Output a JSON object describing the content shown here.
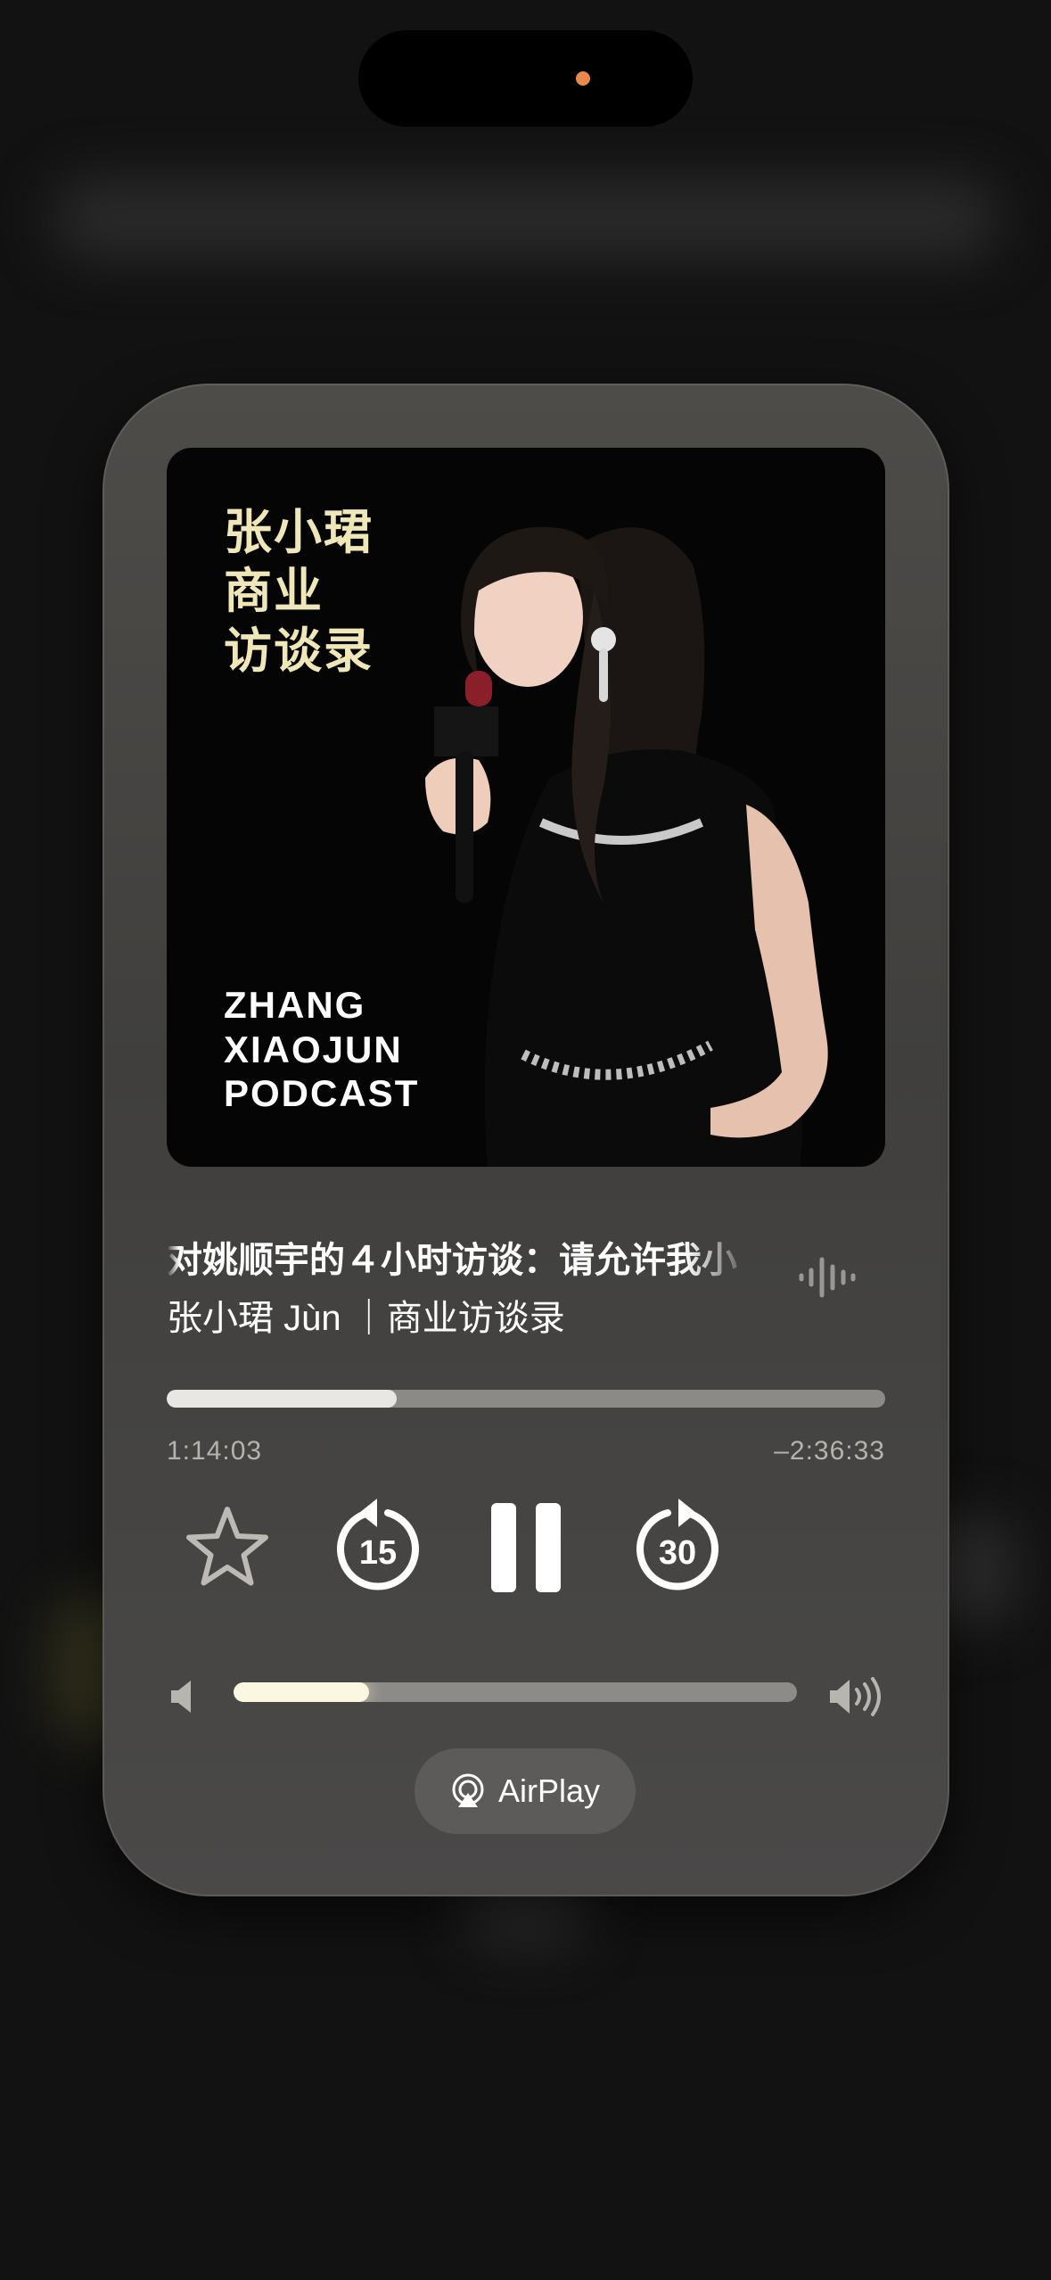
{
  "artwork": {
    "cn_lines": [
      "张小珺",
      "商业",
      "访谈录"
    ],
    "en_lines": [
      "ZHANG",
      "XIAOJUN",
      "PODCAST"
    ]
  },
  "now_playing": {
    "title": "对姚顺宇的４小时访谈：请允许我小",
    "artist": "张小珺 Jùn ｜商业访谈录"
  },
  "playback": {
    "elapsed": "1:14:03",
    "remaining": "–2:36:33",
    "progress_fraction": 0.32
  },
  "controls": {
    "skip_back_seconds": "15",
    "skip_forward_seconds": "30"
  },
  "volume": {
    "level_fraction": 0.24
  },
  "airplay": {
    "label": "AirPlay"
  },
  "colors": {
    "accent_volume": "#fbf7e0",
    "artwork_title": "#f0e7b8",
    "island_indicator": "#e8894b"
  },
  "icons": {
    "favorite": "star-icon",
    "skip_back": "skip-back-15-icon",
    "play_state": "pause-icon",
    "skip_forward": "skip-forward-30-icon",
    "waveform": "waveform-icon",
    "volume_low": "speaker-low-icon",
    "volume_high": "speaker-high-icon",
    "airplay": "airplay-icon"
  }
}
